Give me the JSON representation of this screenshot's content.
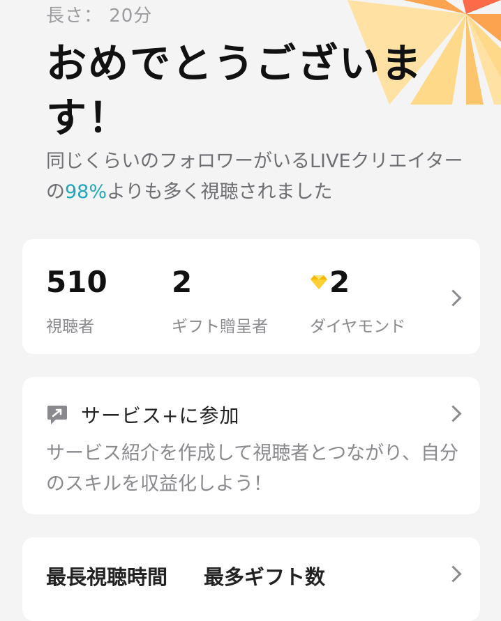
{
  "header": {
    "duration": "長さ： 20分",
    "congrats_title": "おめでとうございます！",
    "subtext_before": "同じくらいのフォロワーがいるLIVEクリエイターの",
    "subtext_percent": "98%",
    "subtext_after": "よりも多く視聴されました"
  },
  "stats": {
    "viewers": {
      "value": "510",
      "label": "視聴者"
    },
    "gifters": {
      "value": "2",
      "label": "ギフト贈呈者"
    },
    "diamonds": {
      "value": "2",
      "label": "ダイヤモンド",
      "icon": "diamond-icon"
    }
  },
  "service": {
    "icon": "chat-bubble-icon",
    "title": "サービス+に参加",
    "description": "サービス紹介を作成して視聴者とつながり、自分のスキルを収益化しよう！"
  },
  "bottom": {
    "tab1": "最長視聴時間",
    "tab2": "最多ギフト数"
  },
  "colors": {
    "background": "#f4f4f5",
    "card": "#ffffff",
    "accent": "#20a6b8",
    "diamond": "#f5b800",
    "burst_light": "#ffd98a",
    "burst_orange": "#fca34f",
    "burst_red": "#fc6a4a"
  }
}
